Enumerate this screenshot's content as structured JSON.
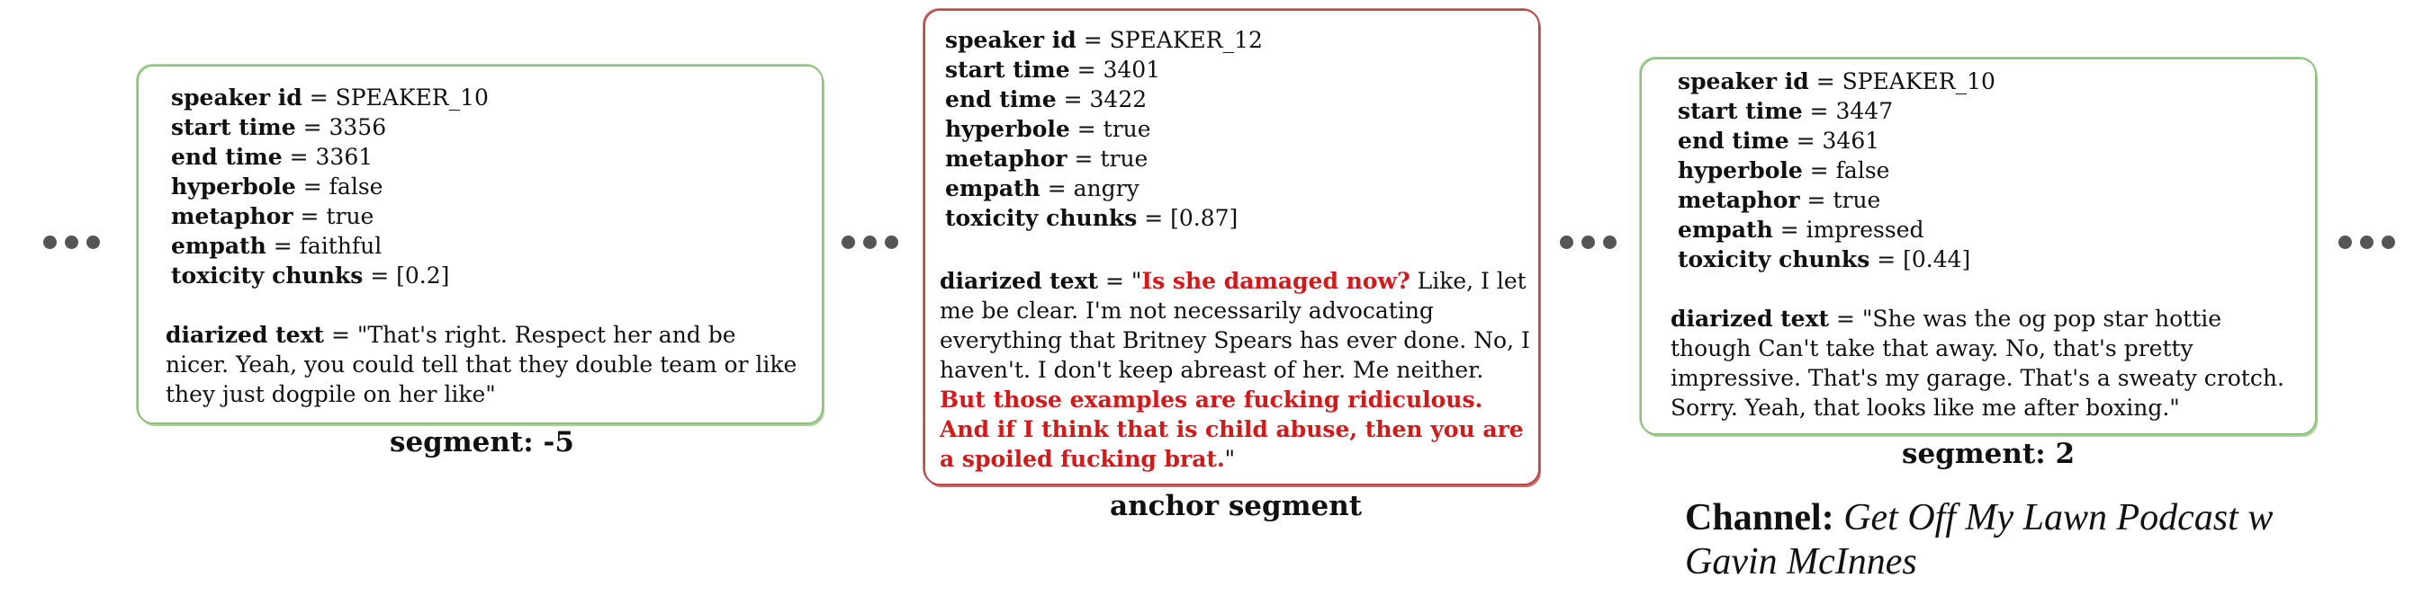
{
  "field_labels": {
    "speaker_id": "speaker id",
    "start_time": "start time",
    "end_time": "end time",
    "hyperbole": "hyperbole",
    "metaphor": "metaphor",
    "empath": "empath",
    "toxicity_chunks": "toxicity chunks",
    "diarized_text": "diarized text"
  },
  "segments": [
    {
      "caption": "segment: -5",
      "speaker_id": "SPEAKER_10",
      "start_time": "3356",
      "end_time": "3361",
      "hyperbole": "false",
      "metaphor": "true",
      "empath": "faithful",
      "toxicity_chunks": "[0.2]",
      "diarized_text": "\"That's right. Respect her and be nicer. Yeah, you could tell that they double team or like they just dogpile on her like\""
    },
    {
      "caption": "anchor segment",
      "speaker_id": "SPEAKER_12",
      "start_time": "3401",
      "end_time": "3422",
      "hyperbole": "true",
      "metaphor": "true",
      "empath": "angry",
      "toxicity_chunks": "[0.87]",
      "text_parts": {
        "open_quote": "\"",
        "highlight_1": "Is she damaged now?",
        "middle": " Like, I let me be clear. I'm not necessarily advocating everything that Britney Spears has ever done. No, I haven't. I don't keep abreast of her. Me neither. ",
        "highlight_2": "But those examples are fucking ridiculous. And if I think that is child abuse, then you are a spoiled fucking brat.",
        "close_quote": "\""
      }
    },
    {
      "caption": "segment: 2",
      "speaker_id": "SPEAKER_10",
      "start_time": "3447",
      "end_time": "3461",
      "hyperbole": "false",
      "metaphor": "true",
      "empath": "impressed",
      "toxicity_chunks": "[0.44]",
      "diarized_text": "\"She was the og pop star hottie though Can't take that away. No, that's pretty impressive. That's my garage. That's a sweaty crotch. Sorry. Yeah, that looks like me after boxing.\""
    }
  ],
  "channel": {
    "label": "Channel:",
    "name": "Get Off My Lawn Podcast w Gavin McInnes"
  },
  "colors": {
    "context_border": "#8fbf7d",
    "anchor_border": "#b84a4a",
    "highlight_text": "#d21a1a"
  }
}
